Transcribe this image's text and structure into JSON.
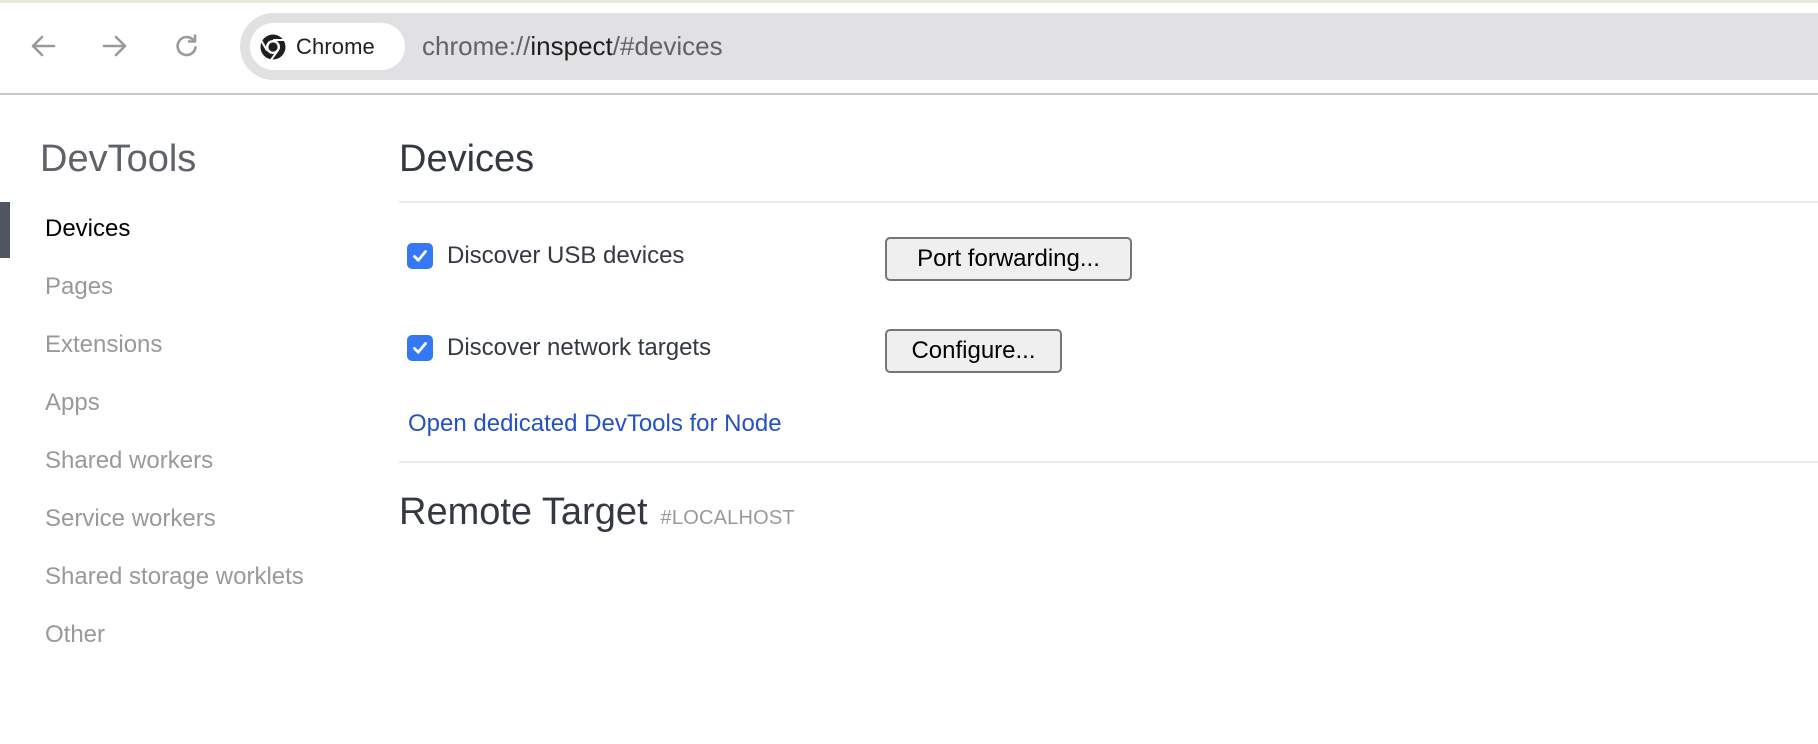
{
  "browser": {
    "nav": {
      "back_icon": "arrow-left-icon",
      "forward_icon": "arrow-right-icon",
      "reload_icon": "reload-icon"
    },
    "site_chip": {
      "icon": "chrome-logo-icon",
      "label": "Chrome"
    },
    "url": {
      "scheme": "chrome://",
      "host": "inspect",
      "path": "/#devices"
    }
  },
  "sidebar": {
    "title": "DevTools",
    "items": [
      {
        "label": "Devices",
        "active": true
      },
      {
        "label": "Pages",
        "active": false
      },
      {
        "label": "Extensions",
        "active": false
      },
      {
        "label": "Apps",
        "active": false
      },
      {
        "label": "Shared workers",
        "active": false
      },
      {
        "label": "Service workers",
        "active": false
      },
      {
        "label": "Shared storage worklets",
        "active": false
      },
      {
        "label": "Other",
        "active": false
      }
    ]
  },
  "main": {
    "title": "Devices",
    "options": [
      {
        "label": "Discover USB devices",
        "checked": true,
        "button_label": "Port forwarding..."
      },
      {
        "label": "Discover network targets",
        "checked": true,
        "button_label": "Configure..."
      }
    ],
    "node_link": "Open dedicated DevTools for Node",
    "remote_target": {
      "title": "Remote Target",
      "subtitle": "#LOCALHOST"
    }
  },
  "colors": {
    "checkbox": "#3478f6",
    "link": "#2352c2",
    "active_indicator": "#4f5561",
    "omnibox_bg": "#e1e1e3"
  }
}
